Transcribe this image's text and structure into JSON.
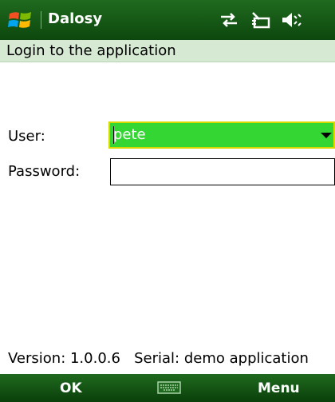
{
  "titlebar": {
    "app_title": "Dalosy"
  },
  "status_icons": [
    "connectivity-arrows-icon",
    "connection-icon",
    "volume-off-icon"
  ],
  "subheader": {
    "text": "Login to the application"
  },
  "form": {
    "user_label": "User:",
    "user_value": "pete",
    "password_label": "Password:",
    "password_value": ""
  },
  "footer": {
    "version_text": "Version: 1.0.0.6",
    "serial_text": "Serial: demo application"
  },
  "softkeys": {
    "left": "OK",
    "right": "Menu"
  },
  "colors": {
    "titlebar": "#1a5e1a",
    "subheader": "#d6ead3",
    "combo_fill": "#33d633",
    "combo_border": "#d9d900",
    "softkey_bar": "#155515"
  }
}
